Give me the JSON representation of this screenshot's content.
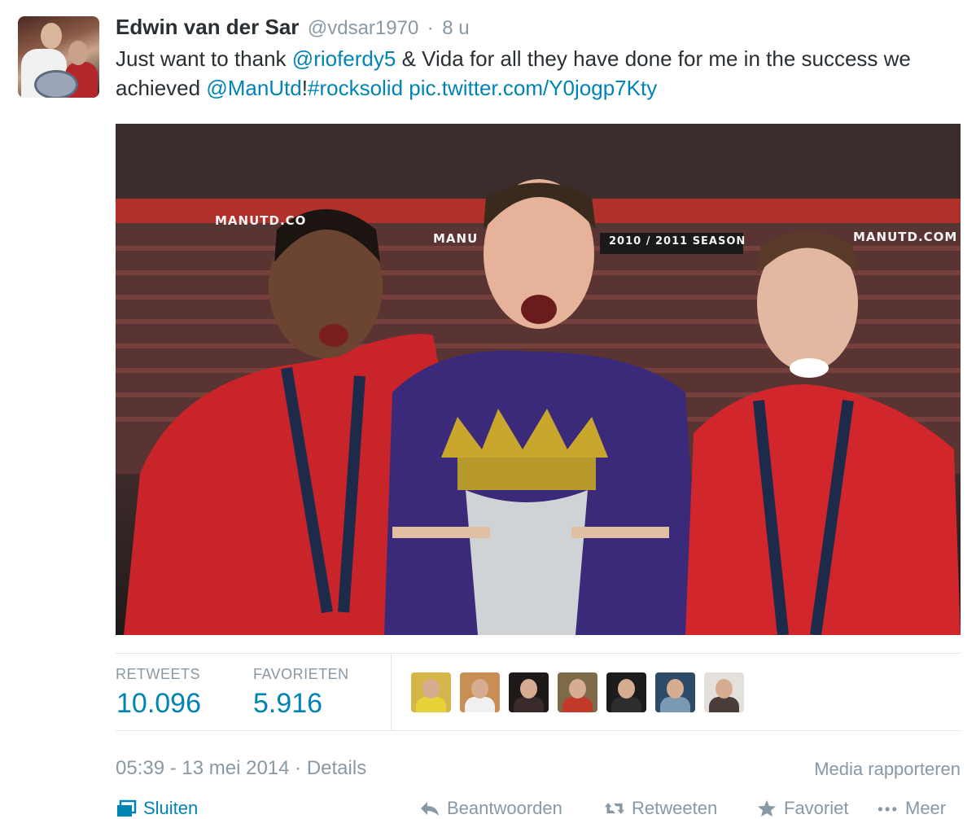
{
  "tweet": {
    "author_name": "Edwin van der Sar",
    "handle": "@vdsar1970",
    "separator": "·",
    "age": "8 u",
    "text_parts": {
      "p1": "Just want to thank ",
      "mention1": "@rioferdy5",
      "p2": " & Vida for all they have done for me in the success we achieved ",
      "mention2": "@ManUtd",
      "p3": "!",
      "hashtag": "#rocksolid",
      "p4": " ",
      "pic_link": "pic.twitter.com/Y0jogp7Kty"
    },
    "photo_banners": {
      "b1": "MANUTD.CO",
      "b2": "MANU",
      "b3": "2010 / 2011 SEASON",
      "b4": "MANUTD.COM"
    }
  },
  "stats": {
    "retweets_label": "RETWEETS",
    "retweets_value": "10.096",
    "favorites_label": "FAVORIETEN",
    "favorites_value": "5.916"
  },
  "favoriters": [
    {
      "icon": "user-avatar",
      "bg": "#d4b64a",
      "body": "#e8d23a"
    },
    {
      "icon": "user-avatar",
      "bg": "#c98e55",
      "body": "#f0f0f0"
    },
    {
      "icon": "user-avatar",
      "bg": "#1f1a1a",
      "body": "#3a2a2a"
    },
    {
      "icon": "user-avatar",
      "bg": "#7c6a48",
      "body": "#c23a2a"
    },
    {
      "icon": "user-avatar",
      "bg": "#1c1c1c",
      "body": "#2e2e2e"
    },
    {
      "icon": "user-avatar",
      "bg": "#2d4a66",
      "body": "#7a9ab4"
    },
    {
      "icon": "user-avatar",
      "bg": "#e4e0dc",
      "body": "#4a3e3a"
    }
  ],
  "footer": {
    "timestamp": "05:39 - 13 mei 2014",
    "separator": "·",
    "details": "Details",
    "report": "Media rapporteren"
  },
  "actions": {
    "close": "Sluiten",
    "reply": "Beantwoorden",
    "retweet": "Retweeten",
    "favorite": "Favoriet",
    "more": "Meer"
  },
  "colors": {
    "link": "#0084b4",
    "muted": "#8899a6",
    "text": "#292f33"
  }
}
